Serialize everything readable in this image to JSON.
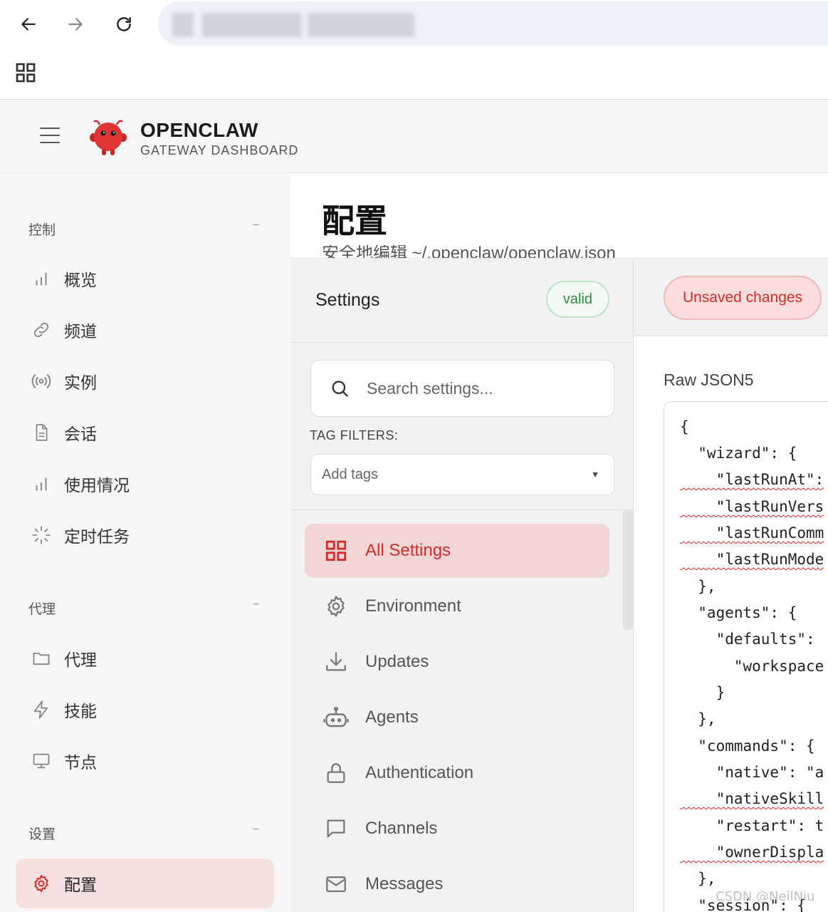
{
  "browser": {
    "back_icon": "arrow-left-icon",
    "forward_icon": "arrow-right-icon",
    "reload_icon": "reload-icon",
    "apps_icon": "grid-icon"
  },
  "header": {
    "brand_title": "OPENCLAW",
    "brand_subtitle": "GATEWAY DASHBOARD"
  },
  "sidebar": {
    "groups": [
      {
        "label": "控制",
        "collapse": "−"
      },
      {
        "label": "代理",
        "collapse": "−"
      },
      {
        "label": "设置",
        "collapse": "−"
      }
    ],
    "items": [
      {
        "label": "概览",
        "icon": "bar-chart-icon"
      },
      {
        "label": "频道",
        "icon": "link-icon"
      },
      {
        "label": "实例",
        "icon": "broadcast-icon"
      },
      {
        "label": "会话",
        "icon": "document-icon"
      },
      {
        "label": "使用情况",
        "icon": "bar-chart-icon"
      },
      {
        "label": "定时任务",
        "icon": "loader-icon"
      },
      {
        "label": "代理",
        "icon": "folder-icon"
      },
      {
        "label": "技能",
        "icon": "lightning-icon"
      },
      {
        "label": "节点",
        "icon": "monitor-icon"
      },
      {
        "label": "配置",
        "icon": "gear-icon",
        "active": true
      }
    ]
  },
  "main": {
    "title": "配置",
    "subtitle": "安全地编辑 ~/.openclaw/openclaw.json"
  },
  "settings": {
    "title": "Settings",
    "status": "valid",
    "search_placeholder": "Search settings...",
    "tag_filters_label": "TAG FILTERS:",
    "tag_placeholder": "Add tags",
    "categories": [
      {
        "label": "All Settings",
        "icon": "grid-icon",
        "active": true
      },
      {
        "label": "Environment",
        "icon": "gear-icon"
      },
      {
        "label": "Updates",
        "icon": "download-icon"
      },
      {
        "label": "Agents",
        "icon": "robot-icon"
      },
      {
        "label": "Authentication",
        "icon": "lock-icon"
      },
      {
        "label": "Channels",
        "icon": "chat-icon"
      },
      {
        "label": "Messages",
        "icon": "mail-icon"
      }
    ]
  },
  "editor": {
    "unsaved_label": "Unsaved changes",
    "raw_label": "Raw JSON5",
    "lines": [
      "{",
      "  \"wizard\": {",
      "    \"lastRunAt\":",
      "    \"lastRunVers",
      "    \"lastRunComm",
      "    \"lastRunMode",
      "  },",
      "  \"agents\": {",
      "    \"defaults\":",
      "      \"workspace",
      "    }",
      "  },",
      "  \"commands\": {",
      "    \"native\": \"a",
      "    \"nativeSkill",
      "    \"restart\": t",
      "    \"ownerDispla",
      "  },",
      "  \"session\": {"
    ]
  },
  "watermark": "CSDN @NeilNiu"
}
